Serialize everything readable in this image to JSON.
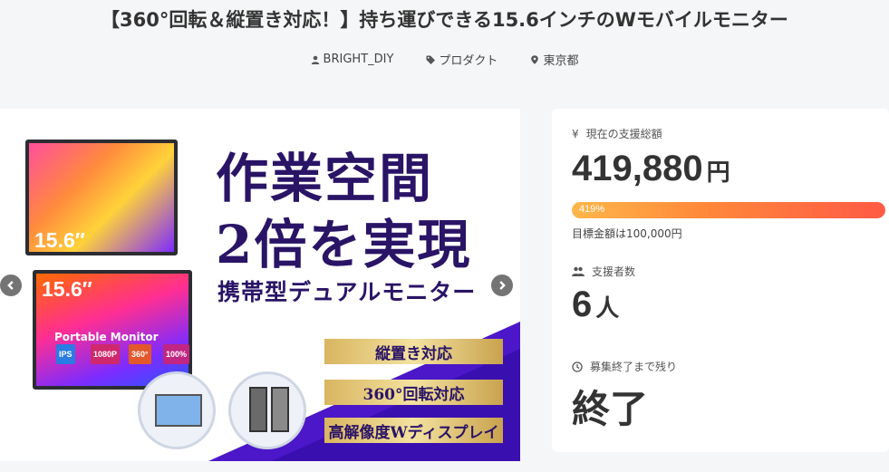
{
  "header": {
    "title": "【360°回転＆縦置き対応！】持ち運びできる15.6インチのWモバイルモニター",
    "author": "BRIGHT_DIY",
    "category": "プロダクト",
    "location": "東京都",
    "author_icon": "user-icon",
    "category_icon": "tag-icon",
    "location_icon": "map-pin-icon"
  },
  "hero": {
    "headline_1": "作業空間",
    "headline_2": "2倍を実現",
    "subheadline": "携帯型デュアルモニター",
    "size_top": "15.6″",
    "size_bottom": "15.6″",
    "monitor_caption": "Portable Monitor",
    "badges": [
      "IPS",
      "1080P",
      "360°",
      "100%"
    ],
    "feature_1": "縦置き対応",
    "feature_2": "360°回転対応",
    "feature_3": "高解像度Wディスプレイ",
    "colors": {
      "headline": "#2a1466",
      "accent_purple": "#4b17c9",
      "gold": "#e8cd7f"
    }
  },
  "funding": {
    "raised_label": "現在の支援総額",
    "raised_amount": "419,880",
    "raised_unit": "円",
    "percent_label": "419%",
    "percent": 419,
    "goal_text": "目標金額は100,000円",
    "backers_label": "支援者数",
    "backers_count": "6",
    "backers_unit": "人",
    "remaining_label": "募集終了まで残り",
    "remaining_value": "終了",
    "colors": {
      "progress_start": "#ffb74a",
      "progress_end": "#ff5a45"
    }
  }
}
